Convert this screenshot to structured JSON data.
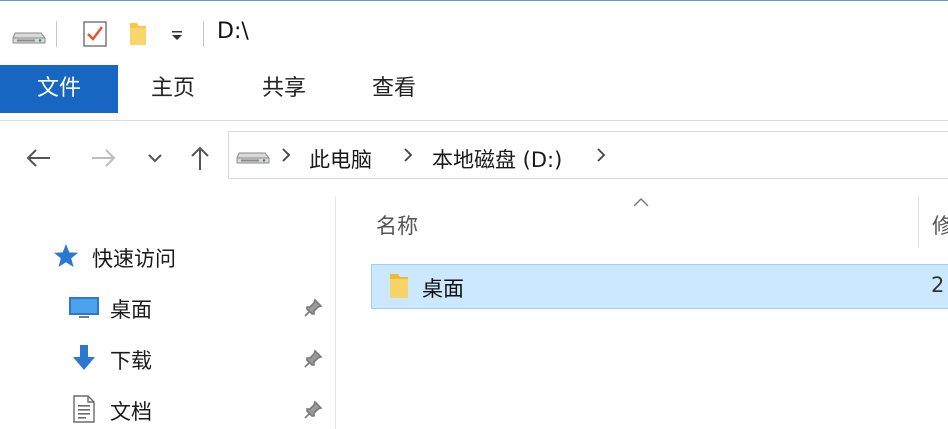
{
  "window": {
    "title": "D:\\"
  },
  "ribbon": {
    "tabs": [
      {
        "label": "文件",
        "active": true
      },
      {
        "label": "主页"
      },
      {
        "label": "共享"
      },
      {
        "label": "查看"
      }
    ]
  },
  "address": {
    "breadcrumbs": [
      "此电脑",
      "本地磁盘 (D:)"
    ]
  },
  "nav_pane": {
    "quick_access": {
      "label": "快速访问",
      "icon": "star-icon"
    },
    "items": [
      {
        "label": "桌面",
        "icon": "desktop-icon",
        "pinned": true
      },
      {
        "label": "下载",
        "icon": "download-icon",
        "pinned": true
      },
      {
        "label": "文档",
        "icon": "document-icon",
        "pinned": true
      }
    ]
  },
  "content": {
    "columns": [
      "名称",
      "修"
    ],
    "files": [
      {
        "name": "桌面",
        "type": "folder",
        "date_prefix": "2",
        "selected": true
      }
    ]
  },
  "colors": {
    "accent": "#1766c1",
    "selection": "#cce8ff",
    "selection_border": "#99d1ff",
    "folder": "#f5c84c"
  }
}
